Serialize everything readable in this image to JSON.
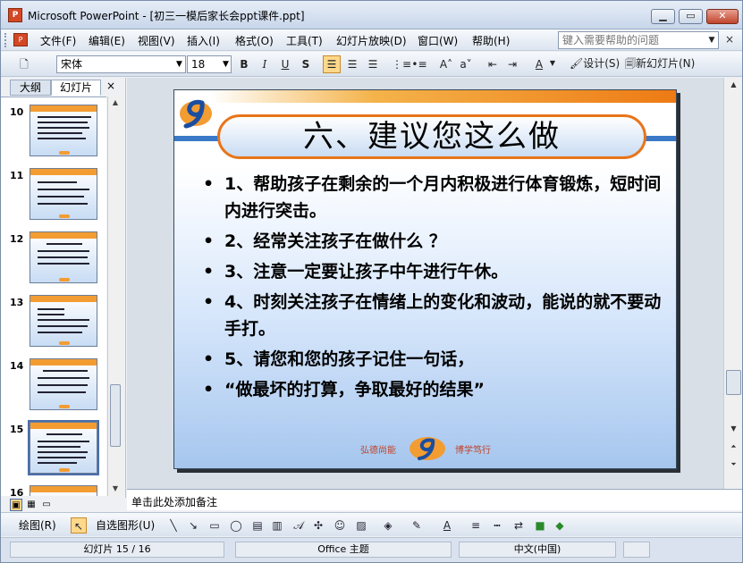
{
  "window": {
    "title": "Microsoft PowerPoint - [初三一模后家长会ppt课件.ppt]",
    "app_icon": "P",
    "minimize_icon": "minimize-icon",
    "maximize_icon": "maximize-icon",
    "close_icon": "close-icon"
  },
  "menu": {
    "items": [
      "文件(F)",
      "编辑(E)",
      "视图(V)",
      "插入(I)",
      "格式(O)",
      "工具(T)",
      "幻灯片放映(D)",
      "窗口(W)",
      "帮助(H)"
    ],
    "help_placeholder": "键入需要帮助的问题",
    "close_glyph": "×"
  },
  "toolbar": {
    "font_name": "宋体",
    "font_size": "18",
    "bold": "B",
    "italic": "I",
    "underline": "U",
    "shadow": "S",
    "font_color": "A",
    "design_label": "设计(S)",
    "new_slide_label": "新幻灯片(N)"
  },
  "left_pane": {
    "tabs": [
      "大纲",
      "幻灯片"
    ],
    "close_glyph": "×",
    "thumbnails": [
      {
        "number": "10",
        "selected": false
      },
      {
        "number": "11",
        "selected": false
      },
      {
        "number": "12",
        "selected": false
      },
      {
        "number": "13",
        "selected": false
      },
      {
        "number": "14",
        "selected": false
      },
      {
        "number": "15",
        "selected": true
      },
      {
        "number": "16",
        "selected": false
      }
    ]
  },
  "slide": {
    "title": "六、建议您这么做",
    "bullets": [
      "1、帮助孩子在剩余的一个月内积极进行体育锻炼，短时间内进行突击。",
      "2、经常关注孩子在做什么 ？",
      "3、注意一定要让孩子中午进行午休。",
      "4、时刻关注孩子在情绪上的变化和波动，能说的就不要动手打。",
      "5、请您和您的孩子记住一句话，",
      "“做最坏的打算，争取最好的结果”"
    ],
    "footer_left": "弘德尚能",
    "footer_right": "博学笃行",
    "colors": {
      "accent_orange": "#ee7a14",
      "accent_blue": "#3a78c8"
    }
  },
  "notes": {
    "placeholder": "单击此处添加备注"
  },
  "drawing_toolbar": {
    "draw_label": "绘图(R)",
    "autoshape_label": "自选图形(U)"
  },
  "status": {
    "slide_position": "幻灯片 15 / 16",
    "theme": "Office 主题",
    "language": "中文(中国)"
  }
}
